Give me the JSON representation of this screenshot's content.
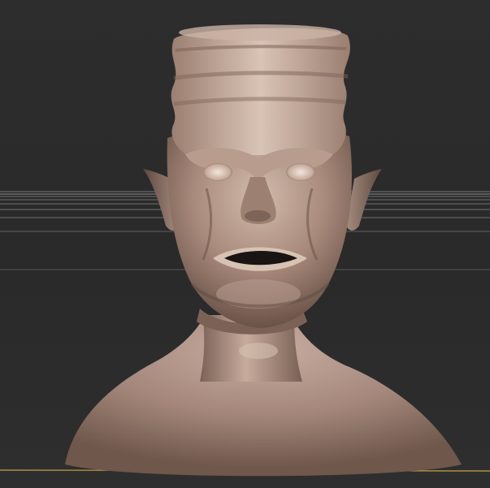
{
  "viewport": {
    "background": "#2b2b2b",
    "grid_color": "#6e6e6e",
    "horizon_line_color": "#8a8a8a",
    "ground_line_color": "#c9a24a"
  },
  "model": {
    "type": "sculpted head bust",
    "skin_color": "#a4877a",
    "highlight_color": "#d8c2b4",
    "shadow_color": "#5a463d"
  }
}
